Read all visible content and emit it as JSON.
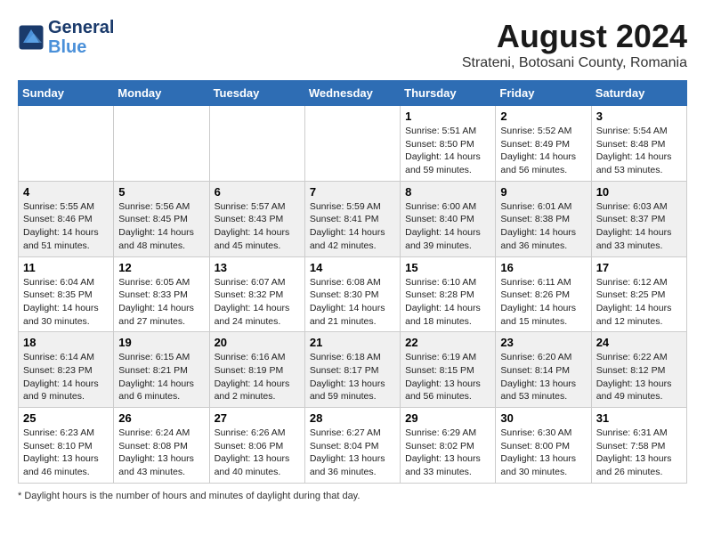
{
  "header": {
    "logo_line1": "General",
    "logo_line2": "Blue",
    "month": "August 2024",
    "location": "Strateni, Botosani County, Romania"
  },
  "days_of_week": [
    "Sunday",
    "Monday",
    "Tuesday",
    "Wednesday",
    "Thursday",
    "Friday",
    "Saturday"
  ],
  "footer": {
    "note": "Daylight hours"
  },
  "weeks": [
    [
      {
        "day": "",
        "info": ""
      },
      {
        "day": "",
        "info": ""
      },
      {
        "day": "",
        "info": ""
      },
      {
        "day": "",
        "info": ""
      },
      {
        "day": "1",
        "info": "Sunrise: 5:51 AM\nSunset: 8:50 PM\nDaylight: 14 hours and 59 minutes."
      },
      {
        "day": "2",
        "info": "Sunrise: 5:52 AM\nSunset: 8:49 PM\nDaylight: 14 hours and 56 minutes."
      },
      {
        "day": "3",
        "info": "Sunrise: 5:54 AM\nSunset: 8:48 PM\nDaylight: 14 hours and 53 minutes."
      }
    ],
    [
      {
        "day": "4",
        "info": "Sunrise: 5:55 AM\nSunset: 8:46 PM\nDaylight: 14 hours and 51 minutes."
      },
      {
        "day": "5",
        "info": "Sunrise: 5:56 AM\nSunset: 8:45 PM\nDaylight: 14 hours and 48 minutes."
      },
      {
        "day": "6",
        "info": "Sunrise: 5:57 AM\nSunset: 8:43 PM\nDaylight: 14 hours and 45 minutes."
      },
      {
        "day": "7",
        "info": "Sunrise: 5:59 AM\nSunset: 8:41 PM\nDaylight: 14 hours and 42 minutes."
      },
      {
        "day": "8",
        "info": "Sunrise: 6:00 AM\nSunset: 8:40 PM\nDaylight: 14 hours and 39 minutes."
      },
      {
        "day": "9",
        "info": "Sunrise: 6:01 AM\nSunset: 8:38 PM\nDaylight: 14 hours and 36 minutes."
      },
      {
        "day": "10",
        "info": "Sunrise: 6:03 AM\nSunset: 8:37 PM\nDaylight: 14 hours and 33 minutes."
      }
    ],
    [
      {
        "day": "11",
        "info": "Sunrise: 6:04 AM\nSunset: 8:35 PM\nDaylight: 14 hours and 30 minutes."
      },
      {
        "day": "12",
        "info": "Sunrise: 6:05 AM\nSunset: 8:33 PM\nDaylight: 14 hours and 27 minutes."
      },
      {
        "day": "13",
        "info": "Sunrise: 6:07 AM\nSunset: 8:32 PM\nDaylight: 14 hours and 24 minutes."
      },
      {
        "day": "14",
        "info": "Sunrise: 6:08 AM\nSunset: 8:30 PM\nDaylight: 14 hours and 21 minutes."
      },
      {
        "day": "15",
        "info": "Sunrise: 6:10 AM\nSunset: 8:28 PM\nDaylight: 14 hours and 18 minutes."
      },
      {
        "day": "16",
        "info": "Sunrise: 6:11 AM\nSunset: 8:26 PM\nDaylight: 14 hours and 15 minutes."
      },
      {
        "day": "17",
        "info": "Sunrise: 6:12 AM\nSunset: 8:25 PM\nDaylight: 14 hours and 12 minutes."
      }
    ],
    [
      {
        "day": "18",
        "info": "Sunrise: 6:14 AM\nSunset: 8:23 PM\nDaylight: 14 hours and 9 minutes."
      },
      {
        "day": "19",
        "info": "Sunrise: 6:15 AM\nSunset: 8:21 PM\nDaylight: 14 hours and 6 minutes."
      },
      {
        "day": "20",
        "info": "Sunrise: 6:16 AM\nSunset: 8:19 PM\nDaylight: 14 hours and 2 minutes."
      },
      {
        "day": "21",
        "info": "Sunrise: 6:18 AM\nSunset: 8:17 PM\nDaylight: 13 hours and 59 minutes."
      },
      {
        "day": "22",
        "info": "Sunrise: 6:19 AM\nSunset: 8:15 PM\nDaylight: 13 hours and 56 minutes."
      },
      {
        "day": "23",
        "info": "Sunrise: 6:20 AM\nSunset: 8:14 PM\nDaylight: 13 hours and 53 minutes."
      },
      {
        "day": "24",
        "info": "Sunrise: 6:22 AM\nSunset: 8:12 PM\nDaylight: 13 hours and 49 minutes."
      }
    ],
    [
      {
        "day": "25",
        "info": "Sunrise: 6:23 AM\nSunset: 8:10 PM\nDaylight: 13 hours and 46 minutes."
      },
      {
        "day": "26",
        "info": "Sunrise: 6:24 AM\nSunset: 8:08 PM\nDaylight: 13 hours and 43 minutes."
      },
      {
        "day": "27",
        "info": "Sunrise: 6:26 AM\nSunset: 8:06 PM\nDaylight: 13 hours and 40 minutes."
      },
      {
        "day": "28",
        "info": "Sunrise: 6:27 AM\nSunset: 8:04 PM\nDaylight: 13 hours and 36 minutes."
      },
      {
        "day": "29",
        "info": "Sunrise: 6:29 AM\nSunset: 8:02 PM\nDaylight: 13 hours and 33 minutes."
      },
      {
        "day": "30",
        "info": "Sunrise: 6:30 AM\nSunset: 8:00 PM\nDaylight: 13 hours and 30 minutes."
      },
      {
        "day": "31",
        "info": "Sunrise: 6:31 AM\nSunset: 7:58 PM\nDaylight: 13 hours and 26 minutes."
      }
    ]
  ]
}
